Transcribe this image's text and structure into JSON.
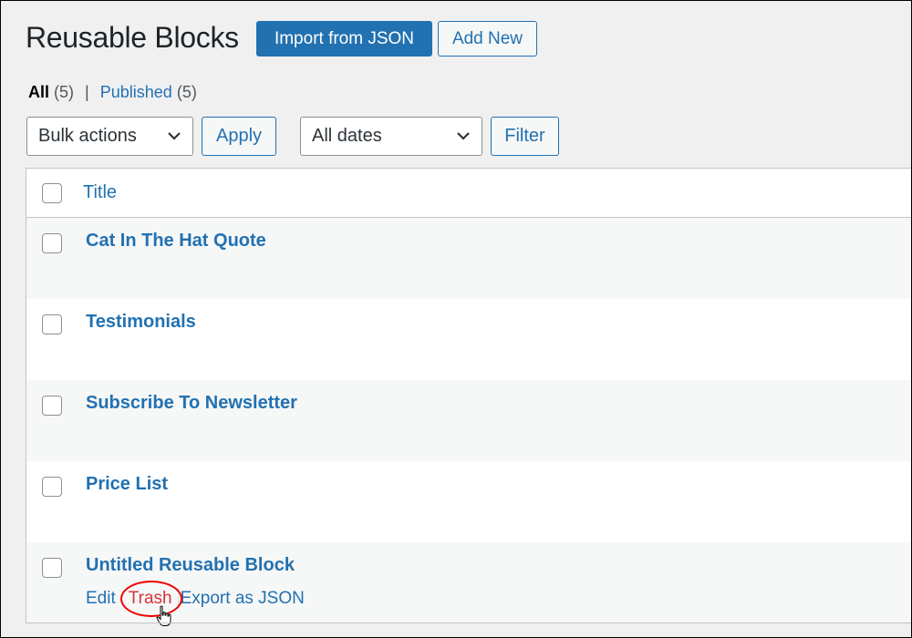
{
  "page": {
    "title": "Reusable Blocks",
    "import_button": "Import from JSON",
    "add_new_button": "Add New"
  },
  "views": {
    "all_label": "All",
    "all_count": "(5)",
    "separator": "|",
    "published_label": "Published",
    "published_count": "(5)"
  },
  "filters": {
    "bulk_actions": "Bulk actions",
    "apply": "Apply",
    "dates": "All dates",
    "filter": "Filter"
  },
  "table": {
    "header_title": "Title",
    "rows": [
      {
        "title": "Cat In The Hat Quote"
      },
      {
        "title": "Testimonials"
      },
      {
        "title": "Subscribe To Newsletter"
      },
      {
        "title": "Price List"
      },
      {
        "title": "Untitled Reusable Block"
      }
    ],
    "row_actions": {
      "edit": "Edit",
      "trash": "Trash",
      "export": "Export as JSON"
    }
  },
  "colors": {
    "accent": "#2271b1",
    "trash": "#d63638",
    "highlight_oval": "#e00000"
  }
}
